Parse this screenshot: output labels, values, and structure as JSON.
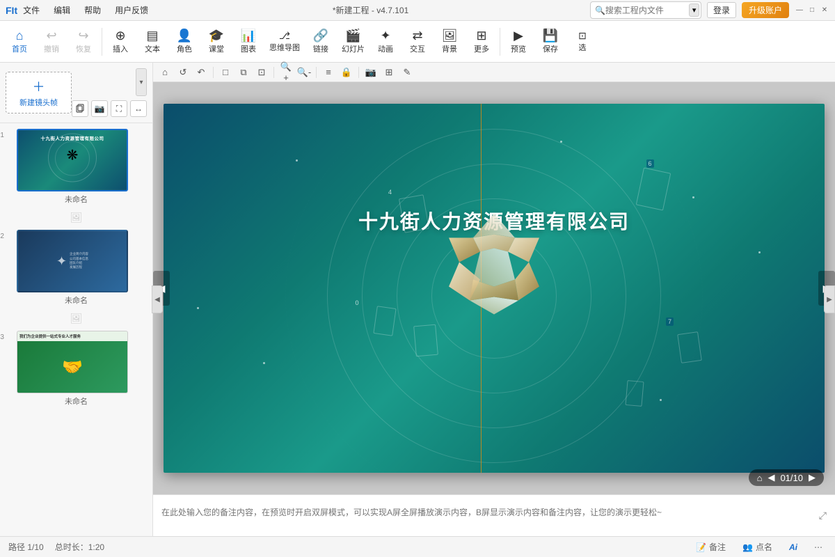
{
  "titlebar": {
    "logo": "FIt",
    "menus": [
      "文件",
      "编辑",
      "帮助",
      "用户反馈"
    ],
    "title": "*新建工程 - v4.7.101",
    "search_placeholder": "搜索工程内文件",
    "login_label": "登录",
    "upgrade_label": "升级账户",
    "win_minimize": "—",
    "win_maximize": "□",
    "win_close": "✕"
  },
  "toolbar": {
    "items": [
      {
        "id": "home",
        "icon": "⌂",
        "label": "首页"
      },
      {
        "id": "undo",
        "icon": "↩",
        "label": "撤销"
      },
      {
        "id": "redo",
        "icon": "↪",
        "label": "恢复"
      },
      {
        "id": "insert",
        "icon": "⊕",
        "label": "插入"
      },
      {
        "id": "text",
        "icon": "▤",
        "label": "文本"
      },
      {
        "id": "role",
        "icon": "👤",
        "label": "角色"
      },
      {
        "id": "classroom",
        "icon": "🏫",
        "label": "课堂"
      },
      {
        "id": "chart",
        "icon": "📊",
        "label": "图表"
      },
      {
        "id": "mindmap",
        "icon": "🔗",
        "label": "思维导图"
      },
      {
        "id": "link",
        "icon": "🔗",
        "label": "链接"
      },
      {
        "id": "slide",
        "icon": "🎞",
        "label": "幻灯片"
      },
      {
        "id": "animation",
        "icon": "✦",
        "label": "动画"
      },
      {
        "id": "interact",
        "icon": "⇄",
        "label": "交互"
      },
      {
        "id": "background",
        "icon": "🖼",
        "label": "背景"
      },
      {
        "id": "more",
        "icon": "⊞",
        "label": "更多"
      },
      {
        "id": "preview",
        "icon": "▶",
        "label": "预览"
      },
      {
        "id": "save",
        "icon": "💾",
        "label": "保存"
      },
      {
        "id": "select",
        "icon": "⊡",
        "label": "选"
      }
    ]
  },
  "canvas_toolbar": {
    "buttons": [
      "⌂",
      "↺",
      "↶",
      "□",
      "□",
      "□",
      "🔍+",
      "🔍-",
      "≡",
      "🔒",
      "📷",
      "⊞",
      "✎"
    ]
  },
  "slides": [
    {
      "num": "01",
      "label": "未命名",
      "active": true
    },
    {
      "num": "02",
      "label": "未命名",
      "active": false
    },
    {
      "num": "03",
      "label": "未命名",
      "active": false
    }
  ],
  "slide_content": {
    "title": "十九街人力资源管理有限公司"
  },
  "notes": {
    "placeholder": "在此处输入您的备注内容，在预览时开启双屏模式，可以实现A屏全屏播放演示内容，B屏显示演示内容和备注内容，让您的演示更轻松~"
  },
  "page_counter": {
    "current": "01",
    "total": "10",
    "separator": "/"
  },
  "statusbar": {
    "path": "路径 1/10",
    "duration": "总时长：1:20",
    "notes_btn": "备注",
    "rollcall_btn": "点名",
    "ai_label": "Ai"
  },
  "new_frame": {
    "icon": "＋",
    "label": "新建镜头帧"
  }
}
